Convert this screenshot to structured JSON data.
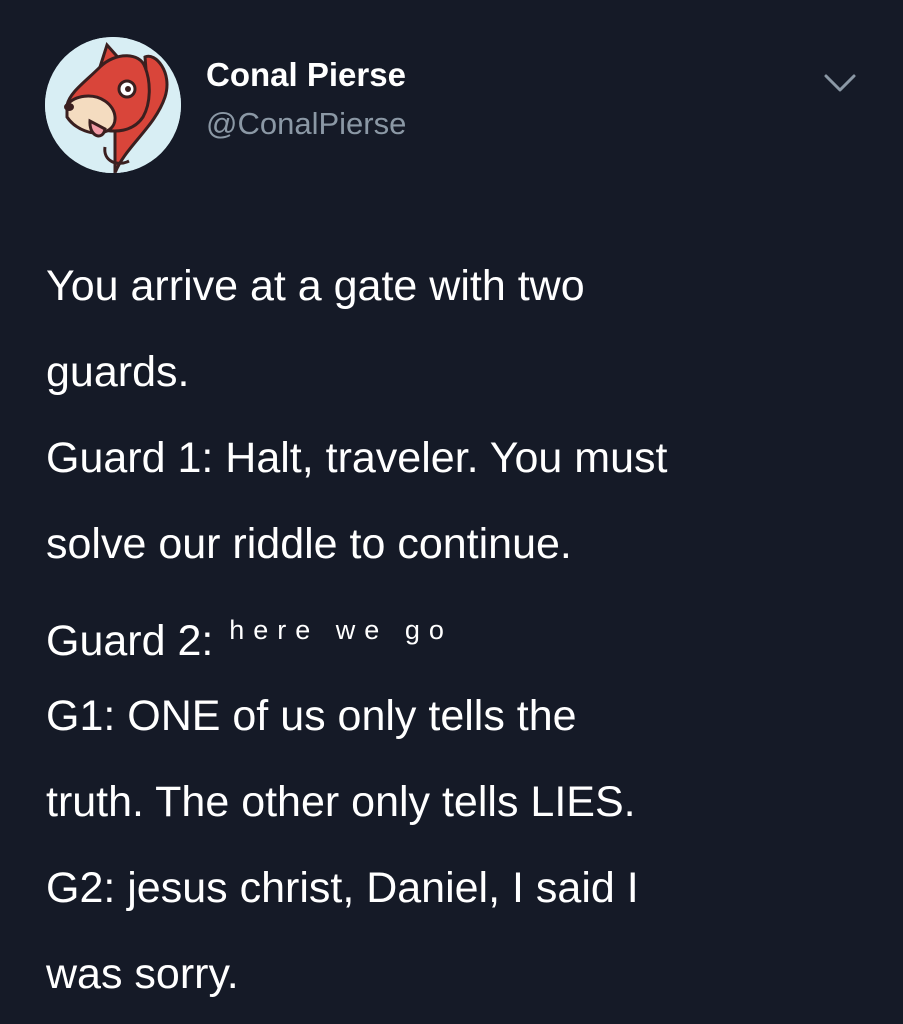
{
  "tweet": {
    "author": {
      "display_name": "Conal Pierse",
      "handle": "@ConalPierse",
      "avatar_icon": "squirrel-cartoon-avatar"
    },
    "menu_icon": "chevron-down-icon",
    "lines": [
      "You arrive at a gate with two",
      "guards.",
      "Guard 1: Halt, traveler. You must",
      "solve our riddle to continue.",
      "Guard 2: ",
      "G1: ONE of us only tells the",
      "truth. The other only tells LIES.",
      "G2: jesus christ, Daniel, I said I",
      "was sorry."
    ],
    "spaced_text": "here we go"
  },
  "colors": {
    "background": "#151a27",
    "text": "#ffffff",
    "handle": "#8b98a5",
    "avatar_red": "#d9453a",
    "avatar_bg": "#d8eef4"
  }
}
